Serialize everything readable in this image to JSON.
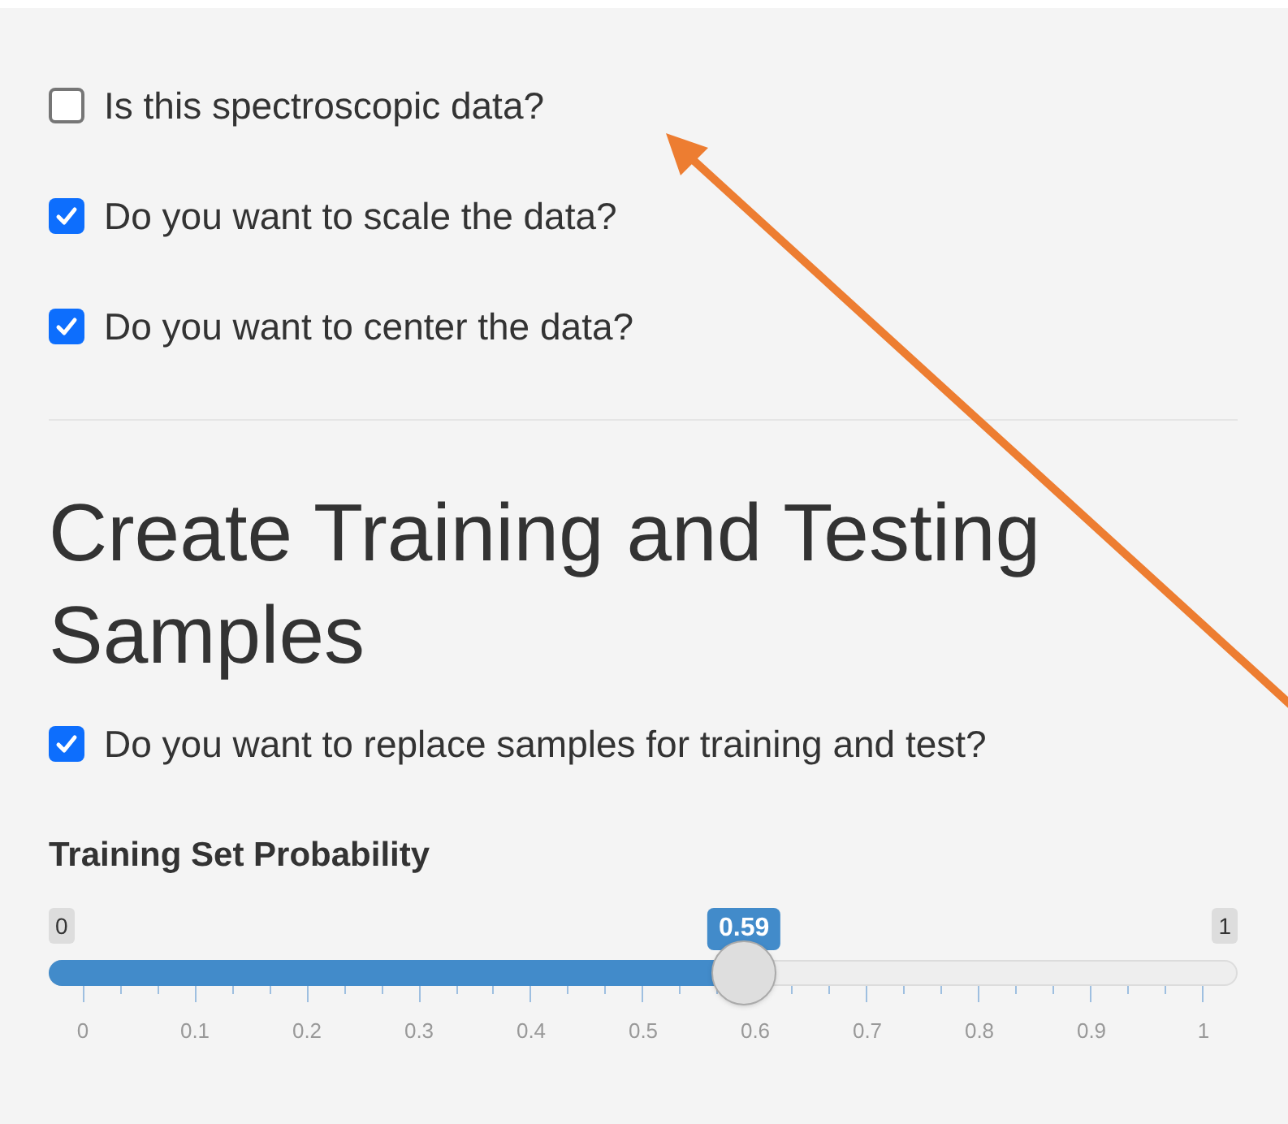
{
  "options": [
    {
      "label": "Is this spectroscopic data?",
      "checked": false
    },
    {
      "label": "Do you want to scale the data?",
      "checked": true
    },
    {
      "label": "Do you want to center the data?",
      "checked": true
    }
  ],
  "section": {
    "heading": "Create Training and Testing Samples",
    "replace": {
      "label": "Do you want to replace samples for training and test?",
      "checked": true
    },
    "slider": {
      "label": "Training Set Probability",
      "min": "0",
      "max": "1",
      "value": "0.59",
      "level": 0.59,
      "ticks": [
        "0",
        "0.1",
        "0.2",
        "0.3",
        "0.4",
        "0.5",
        "0.6",
        "0.7",
        "0.8",
        "0.9",
        "1"
      ]
    }
  }
}
